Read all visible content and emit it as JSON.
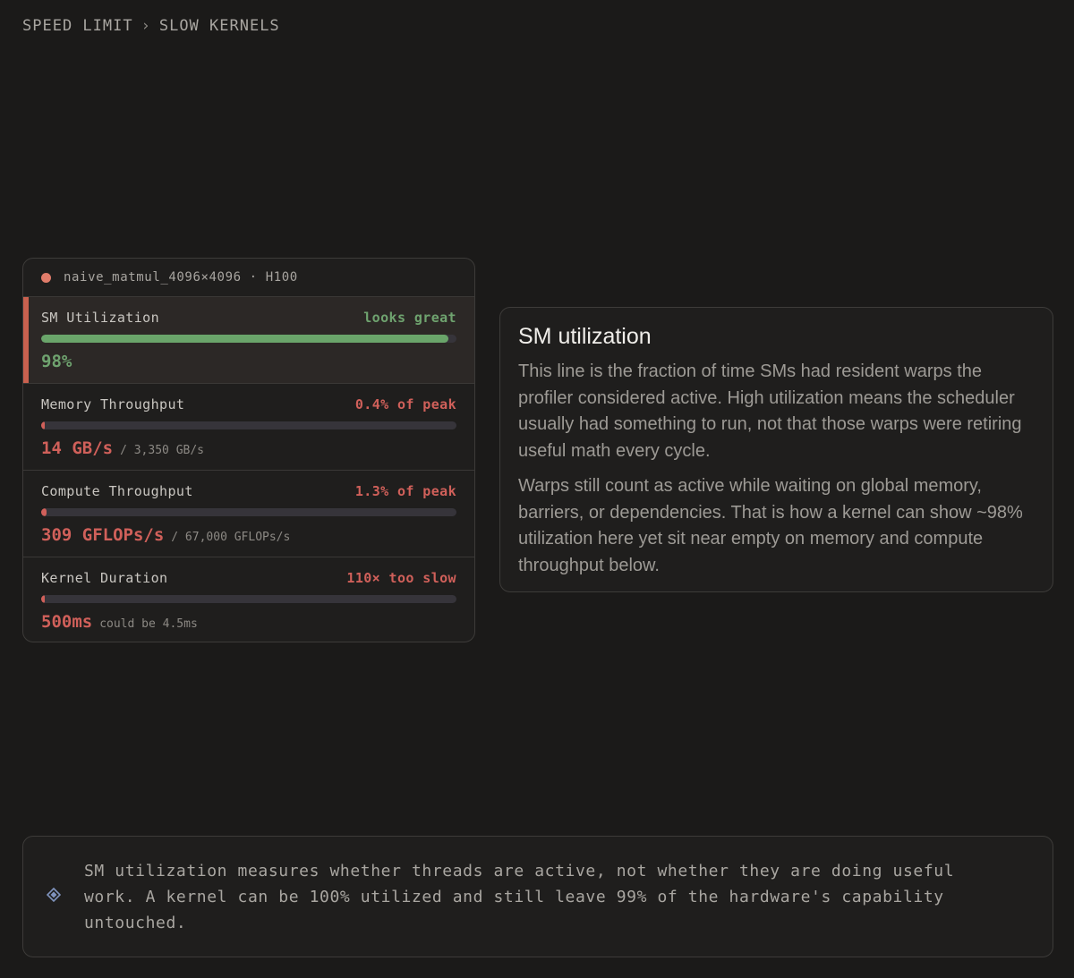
{
  "breadcrumb": {
    "root": "SPEED LIMIT",
    "separator": "›",
    "current": "SLOW KERNELS"
  },
  "card": {
    "title": "naive_matmul_4096×4096 · H100",
    "metrics": [
      {
        "label": "SM Utilization",
        "status": "looks great",
        "fill_fraction": 0.98,
        "value": "98%",
        "sub": "",
        "tone": "good",
        "active": true
      },
      {
        "label": "Memory Throughput",
        "status": "0.4% of peak",
        "fill_fraction": 0.004,
        "value": "14 GB/s",
        "sub": "/ 3,350 GB/s",
        "tone": "bad",
        "active": false
      },
      {
        "label": "Compute Throughput",
        "status": "1.3% of peak",
        "fill_fraction": 0.013,
        "value": "309 GFLOPs/s",
        "sub": "/ 67,000 GFLOPs/s",
        "tone": "bad",
        "active": false
      },
      {
        "label": "Kernel Duration",
        "status": "110× too slow",
        "fill_fraction": 0.009,
        "value": "500ms",
        "sub": "could be 4.5ms",
        "tone": "bad",
        "active": false
      }
    ]
  },
  "panel": {
    "title": "SM utilization",
    "paragraphs": [
      "This line is the fraction of time SMs had resident warps the profiler considered active. High utilization means the scheduler usually had something to run, not that those warps were retiring useful math every cycle.",
      "Warps still count as active while waiting on global memory, barriers, or dependencies. That is how a kernel can show ~98% utilization here yet sit near empty on memory and compute throughput below."
    ]
  },
  "note": {
    "icon": "diamond-icon",
    "text": "SM utilization measures whether threads are active, not whether they are doing useful work. A kernel can be 100% utilized and still leave 99% of the hardware's capability untouched."
  },
  "colors": {
    "good": "#6aa56a",
    "bad": "#d0605a",
    "accent_bar": "#c9614f",
    "status_dot": "#e07c6a"
  }
}
